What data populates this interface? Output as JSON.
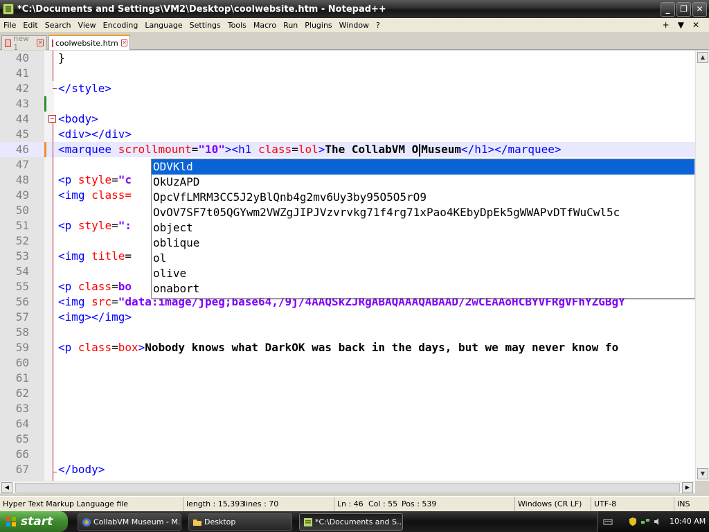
{
  "window": {
    "title": "*C:\\Documents and Settings\\VM2\\Desktop\\coolwebsite.htm - Notepad++",
    "buttons": {
      "minimize": "_",
      "maximize": "❐",
      "close": "✕"
    }
  },
  "menu": {
    "items": [
      "File",
      "Edit",
      "Search",
      "View",
      "Encoding",
      "Language",
      "Settings",
      "Tools",
      "Macro",
      "Run",
      "Plugins",
      "Window",
      "?"
    ],
    "right": [
      "+",
      "▼",
      "✕"
    ]
  },
  "tabs": [
    {
      "label": "new 1",
      "active": false
    },
    {
      "label": "coolwebsite.htm",
      "active": true
    }
  ],
  "editor": {
    "lines": [
      {
        "num": "40",
        "segs": [
          [
            "plain",
            "}"
          ]
        ]
      },
      {
        "num": "41",
        "segs": []
      },
      {
        "num": "42",
        "segs": [
          [
            "tag",
            "</style>"
          ]
        ]
      },
      {
        "num": "43",
        "segs": []
      },
      {
        "num": "44",
        "segs": [
          [
            "tag",
            "<body>"
          ]
        ]
      },
      {
        "num": "45",
        "segs": [
          [
            "tag",
            "<div></div>"
          ]
        ]
      },
      {
        "num": "46",
        "segs": [
          [
            "tag",
            "<marquee "
          ],
          [
            "attr",
            "scrollmount"
          ],
          [
            "plain",
            "="
          ],
          [
            "str",
            "\"10\""
          ],
          [
            "tag",
            "><h1 "
          ],
          [
            "attr",
            "class"
          ],
          [
            "plain",
            "="
          ],
          [
            "attr",
            "lol"
          ],
          [
            "tag",
            ">"
          ],
          [
            "txt",
            "The CollabVM O"
          ],
          [
            "caret",
            ""
          ],
          [
            "txt",
            "Museum"
          ],
          [
            "tag",
            "</h1></marquee>"
          ]
        ]
      },
      {
        "num": "47",
        "segs": []
      },
      {
        "num": "48",
        "segs": [
          [
            "tag",
            "<p "
          ],
          [
            "attr",
            "style"
          ],
          [
            "plain",
            "="
          ],
          [
            "str",
            "\"c"
          ]
        ]
      },
      {
        "num": "49",
        "segs": [
          [
            "tag",
            "<img "
          ],
          [
            "attr",
            "class="
          ]
        ]
      },
      {
        "num": "50",
        "segs": []
      },
      {
        "num": "51",
        "segs": [
          [
            "tag",
            "<p "
          ],
          [
            "attr",
            "style"
          ],
          [
            "plain",
            "="
          ],
          [
            "str",
            "\":"
          ]
        ]
      },
      {
        "num": "52",
        "segs": []
      },
      {
        "num": "53",
        "segs": [
          [
            "tag",
            "<img "
          ],
          [
            "attr",
            "title"
          ],
          [
            "plain",
            "="
          ]
        ]
      },
      {
        "num": "54",
        "segs": []
      },
      {
        "num": "55",
        "segs": [
          [
            "tag",
            "<p "
          ],
          [
            "attr",
            "class"
          ],
          [
            "plain",
            "="
          ],
          [
            "str",
            "bo"
          ]
        ]
      },
      {
        "num": "56",
        "segs": [
          [
            "tag",
            "<img "
          ],
          [
            "attr",
            "src"
          ],
          [
            "plain",
            "="
          ],
          [
            "str",
            "\"data:image/jpeg;base64,/9j/4AAQSkZJRgABAQAAAQABAAD/2wCEAAoHCBYVFRgVFhYZGBgY"
          ]
        ]
      },
      {
        "num": "57",
        "segs": [
          [
            "tag",
            "<img></img>"
          ]
        ]
      },
      {
        "num": "58",
        "segs": []
      },
      {
        "num": "59",
        "segs": [
          [
            "tag",
            "<p "
          ],
          [
            "attr",
            "class"
          ],
          [
            "plain",
            "="
          ],
          [
            "attr",
            "box"
          ],
          [
            "tag",
            ">"
          ],
          [
            "txt",
            "Nobody knows what DarkOK was back in the days, but we may never know fo"
          ]
        ]
      },
      {
        "num": "60",
        "segs": []
      },
      {
        "num": "61",
        "segs": []
      },
      {
        "num": "62",
        "segs": []
      },
      {
        "num": "63",
        "segs": []
      },
      {
        "num": "64",
        "segs": []
      },
      {
        "num": "65",
        "segs": []
      },
      {
        "num": "66",
        "segs": []
      },
      {
        "num": "67",
        "segs": [
          [
            "tag",
            "</body>"
          ]
        ]
      }
    ],
    "current_line": "46"
  },
  "autocomplete": {
    "items": [
      {
        "text": "ODVKld",
        "icon": "",
        "selected": true
      },
      {
        "text": "OkUzAPD",
        "icon": "",
        "selected": false
      },
      {
        "text": "OpcVfLMRM3CC5J2yBlQnb4g2mv6Uy3by95O5O5rO9",
        "icon": "",
        "selected": false
      },
      {
        "text": "OvOV7SF7t05QGYwm2VWZgJIPJVzvrvkg71f4rg71xPao4KEbyDpEk5gWWAPvDTfWuCwl5c",
        "icon": "",
        "selected": false
      },
      {
        "text": "object",
        "icon": "cube-icon",
        "selected": false
      },
      {
        "text": "oblique",
        "icon": "cube-icon",
        "selected": false
      },
      {
        "text": "ol",
        "icon": "cube-icon",
        "selected": false
      },
      {
        "text": "olive",
        "icon": "cube-icon",
        "selected": false
      },
      {
        "text": "onabort",
        "icon": "cube-icon",
        "selected": false
      }
    ]
  },
  "status": {
    "filetype": "Hyper Text Markup Language file",
    "length": "length : 15,393",
    "lines": "lines : 70",
    "ln": "Ln : 46",
    "col": "Col : 55",
    "pos": "Pos : 539",
    "eol": "Windows (CR LF)",
    "encoding": "UTF-8",
    "mode": "INS"
  },
  "taskbar": {
    "start": "start",
    "items": [
      {
        "label": "CollabVM Museum - M...",
        "active": false
      },
      {
        "label": "Desktop",
        "active": false
      },
      {
        "label": "*C:\\Documents and S...",
        "active": true
      }
    ],
    "clock": "10:40 AM"
  },
  "colors": {
    "tag": "#0000ff",
    "attribute": "#ff0000",
    "string": "#8000ff",
    "selection": "#0a64d8"
  }
}
